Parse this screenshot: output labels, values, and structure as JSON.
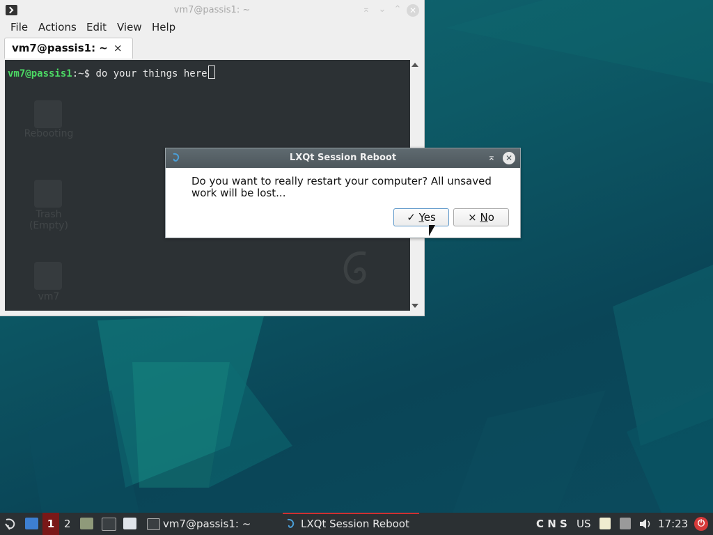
{
  "terminal": {
    "title": "vm7@passis1: ~",
    "menu": [
      "File",
      "Actions",
      "Edit",
      "View",
      "Help"
    ],
    "tab_label": "vm7@passis1: ~",
    "tab_close": "×",
    "prompt_user": "vm7@passis1",
    "prompt_rest": ":~$ ",
    "command": "do your things here",
    "ghost_labels": [
      "Rebooting",
      "Trash\n(Empty)",
      "vm7"
    ]
  },
  "dialog": {
    "title": "LXQt Session Reboot",
    "message": "Do you want to really restart your computer? All unsaved work will be lost...",
    "yes_check": "✓",
    "yes_mnemonic": "Y",
    "yes_rest": "es",
    "no_cross": "×",
    "no_mnemonic": "N",
    "no_rest": "o"
  },
  "taskbar": {
    "desktop_1": "1",
    "desktop_2": "2",
    "task_terminal": "vm7@passis1: ~",
    "task_dialog": "LXQt Session Reboot",
    "indicators": "C N S",
    "keyboard_layout": "US",
    "clock": "17:23"
  },
  "colors": {
    "desktop_bg": "#0e5366",
    "taskbar_bg": "#2b3033",
    "active_desktop": "#7a1818",
    "power_button": "#d63a3a",
    "prompt_green": "#4cd964"
  }
}
